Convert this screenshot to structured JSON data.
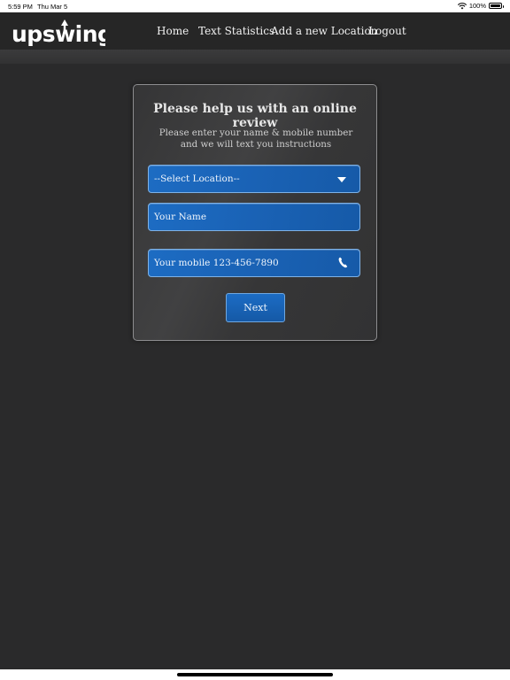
{
  "status_bar": {
    "time": "5:59 PM",
    "date": "Thu Mar 5",
    "battery": "100%",
    "wifi_icon": "wifi-icon",
    "battery_icon": "battery-icon"
  },
  "navbar": {
    "logo_text": "upswing",
    "links": [
      "Home",
      "Text Statistics",
      "Add a new Location",
      "Logout"
    ]
  },
  "form": {
    "title": "Please help us with an online review",
    "subtitle": "Please enter your name & mobile number and we will text you instructions",
    "location_select": {
      "selected": "--Select Location--",
      "icon": "chevron-down-icon"
    },
    "name_field": {
      "placeholder": "Your Name"
    },
    "mobile_field": {
      "placeholder": "Your mobile 123-456-7890",
      "icon": "phone-icon"
    },
    "next_label": "Next"
  },
  "colors": {
    "background": "#2a2a2b",
    "field_blue": "#1a62b5",
    "card_border": "#8d8d8f"
  }
}
